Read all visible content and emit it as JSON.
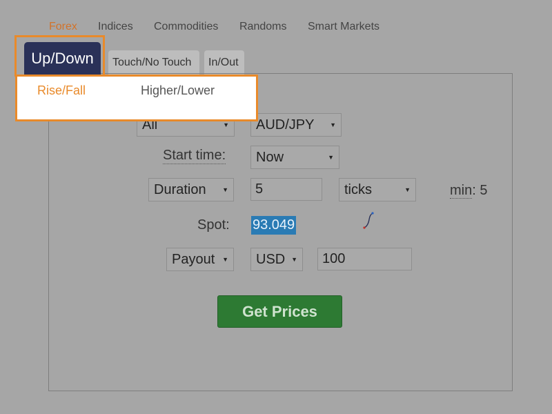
{
  "nav": {
    "items": [
      "Forex",
      "Indices",
      "Commodities",
      "Randoms",
      "Smart Markets"
    ],
    "active": "Forex"
  },
  "subtabs": {
    "active": "Up/Down",
    "others": [
      "Touch/No Touch",
      "In/Out"
    ]
  },
  "dropdown": {
    "items": [
      "Rise/Fall",
      "Higher/Lower"
    ],
    "selected": "Rise/Fall"
  },
  "form": {
    "market_group": "All",
    "underlying": "AUD/JPY",
    "start_time_label": "Start time:",
    "start_time_value": "Now",
    "duration_type": "Duration",
    "duration_value": "5",
    "duration_unit": "ticks",
    "min_label": "min",
    "min_value": ": 5",
    "spot_label": "Spot:",
    "spot_value": "93.049",
    "payout_type": "Payout",
    "currency": "USD",
    "amount": "100",
    "get_prices_label": "Get Prices"
  },
  "colors": {
    "accent_orange": "#e98a2a",
    "active_tab": "#2a3158",
    "button_green": "#2d7a33",
    "spot_highlight": "#2a7bb4"
  }
}
